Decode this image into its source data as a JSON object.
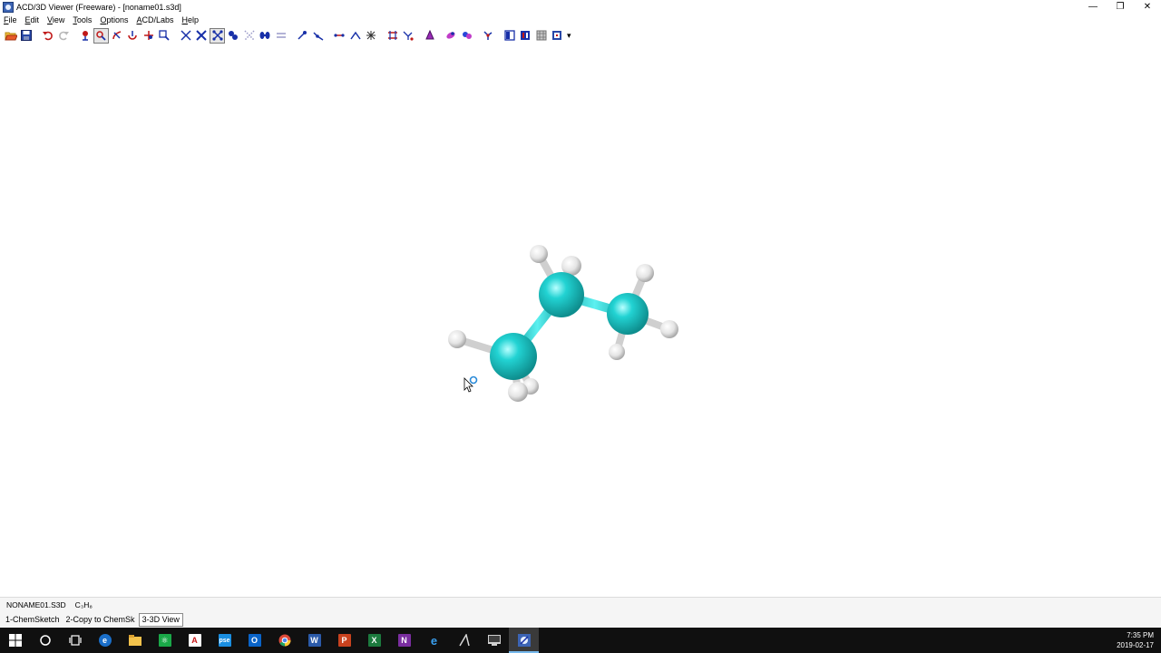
{
  "window": {
    "title": "ACD/3D Viewer (Freeware) - [noname01.s3d]",
    "controls": {
      "minimize": "—",
      "restore": "❐",
      "close": "✕"
    }
  },
  "menu": {
    "items": [
      {
        "first": "F",
        "rest": "ile"
      },
      {
        "first": "E",
        "rest": "dit"
      },
      {
        "first": "V",
        "rest": "iew"
      },
      {
        "first": "T",
        "rest": "ools"
      },
      {
        "first": "O",
        "rest": "ptions"
      },
      {
        "first": "A",
        "rest": "CD/Labs"
      },
      {
        "first": "H",
        "rest": "elp"
      }
    ]
  },
  "toolbar": {
    "more": "▾",
    "icons": [
      "open-icon",
      "save-icon",
      "undo-icon",
      "redo-icon",
      "rotate-icon",
      "rotate-3d-icon",
      "rotate-x-icon",
      "rotate-y-icon",
      "move-icon",
      "zoom-icon",
      "wireframe-icon",
      "sticks-icon",
      "balls-sticks-icon",
      "spacefill-icon",
      "dots-icon",
      "disks-icon",
      "cylinders-icon",
      "measure-icon",
      "angle-icon",
      "bond-length-icon",
      "dihedral-icon",
      "select-icon",
      "hydrogen-icon",
      "labels-icon",
      "color-icon",
      "optimize-icon",
      "surface-icon",
      "orbital-icon",
      "structure-icon",
      "window-icon",
      "grid-icon",
      "settings-icon"
    ],
    "accent": "#0000c8"
  },
  "molecule": {
    "atom_color": "#22d3d3",
    "hydrogen_color": "#e9e9e9"
  },
  "status": {
    "file": "NONAME01.S3D",
    "formula": "C₃H₈"
  },
  "tabs": [
    {
      "label": "1-ChemSketch",
      "active": false
    },
    {
      "label": "2-Copy to ChemSk",
      "active": false
    },
    {
      "label": "3-3D View",
      "active": true
    }
  ],
  "taskbar": {
    "apps": [
      "start-icon",
      "cortana-icon",
      "task-view-icon",
      "edge-icon",
      "file-explorer-icon",
      "chemsketch-icon",
      "acrobat-icon",
      "pse-icon",
      "outlook-icon",
      "chrome-icon",
      "word-icon",
      "powerpoint-icon",
      "excel-icon",
      "onenote-icon",
      "ie-icon",
      "acd-lab-icon",
      "terminal-icon",
      "acd-3d-viewer-icon"
    ],
    "time": "7:35 PM",
    "date": "2019-02-17"
  }
}
